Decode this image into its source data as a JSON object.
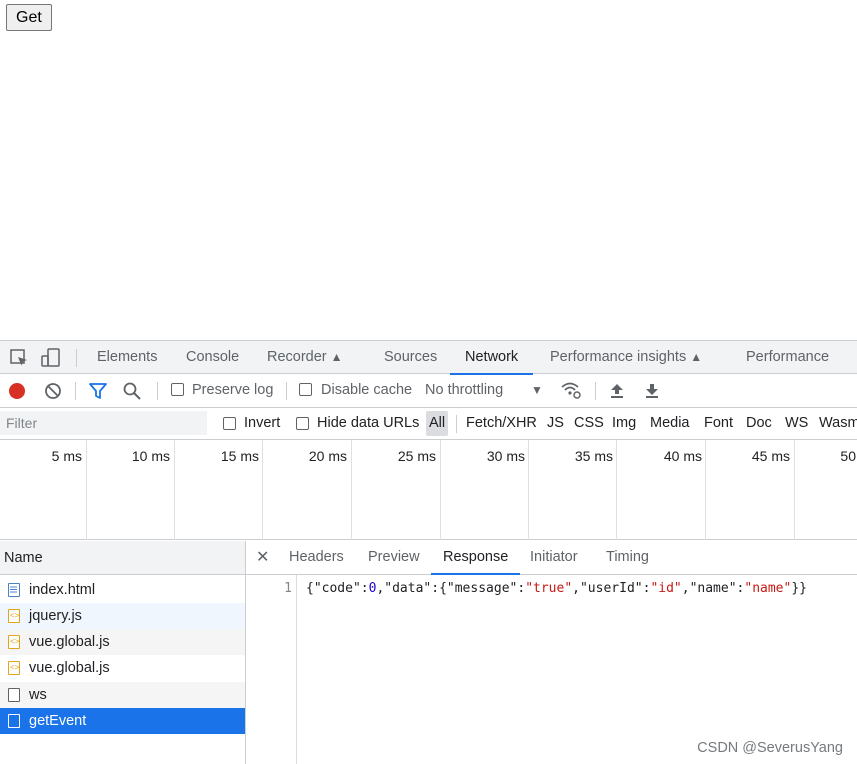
{
  "page": {
    "get_button_label": "Get"
  },
  "devtools": {
    "main_tabs": [
      {
        "label": "Elements"
      },
      {
        "label": "Console"
      },
      {
        "label": "Recorder"
      },
      {
        "label": "Sources"
      },
      {
        "label": "Network",
        "active": true
      },
      {
        "label": "Performance insights"
      },
      {
        "label": "Performance"
      }
    ],
    "toolbar": {
      "preserve_log": "Preserve log",
      "disable_cache": "Disable cache",
      "throttling": "No throttling",
      "record_color": "#d93025"
    },
    "filterbar": {
      "placeholder": "Filter",
      "invert": "Invert",
      "hide_data_urls": "Hide data URLs",
      "types": [
        "All",
        "Fetch/XHR",
        "JS",
        "CSS",
        "Img",
        "Media",
        "Font",
        "Doc",
        "WS",
        "Wasm"
      ]
    },
    "timeline_ticks": [
      "5 ms",
      "10 ms",
      "15 ms",
      "20 ms",
      "25 ms",
      "30 ms",
      "35 ms",
      "40 ms",
      "45 ms",
      "50"
    ],
    "requests": {
      "header": "Name",
      "items": [
        {
          "name": "index.html",
          "icon": "document-icon"
        },
        {
          "name": "jquery.js",
          "icon": "script-icon"
        },
        {
          "name": "vue.global.js",
          "icon": "script-icon"
        },
        {
          "name": "vue.global.js",
          "icon": "script-icon"
        },
        {
          "name": "ws",
          "icon": "blank-file-icon"
        },
        {
          "name": "getEvent",
          "icon": "blank-file-icon",
          "selected": true
        }
      ]
    },
    "detail": {
      "tabs": [
        "Headers",
        "Preview",
        "Response",
        "Initiator",
        "Timing"
      ],
      "active_tab": "Response",
      "line_number": "1",
      "response_tokens": [
        {
          "t": "{",
          "c": "k"
        },
        {
          "t": "\"code\"",
          "c": "k"
        },
        {
          "t": ":",
          "c": "k"
        },
        {
          "t": "0",
          "c": "n"
        },
        {
          "t": ",",
          "c": "k"
        },
        {
          "t": "\"data\"",
          "c": "k"
        },
        {
          "t": ":{",
          "c": "k"
        },
        {
          "t": "\"message\"",
          "c": "k"
        },
        {
          "t": ":",
          "c": "k"
        },
        {
          "t": "\"true\"",
          "c": "s"
        },
        {
          "t": ",",
          "c": "k"
        },
        {
          "t": "\"userId\"",
          "c": "k"
        },
        {
          "t": ":",
          "c": "k"
        },
        {
          "t": "\"id\"",
          "c": "s"
        },
        {
          "t": ",",
          "c": "k"
        },
        {
          "t": "\"name\"",
          "c": "k"
        },
        {
          "t": ":",
          "c": "k"
        },
        {
          "t": "\"name\"",
          "c": "s"
        },
        {
          "t": "}}",
          "c": "k"
        }
      ]
    },
    "watermark": "CSDN @SeverusYang"
  }
}
